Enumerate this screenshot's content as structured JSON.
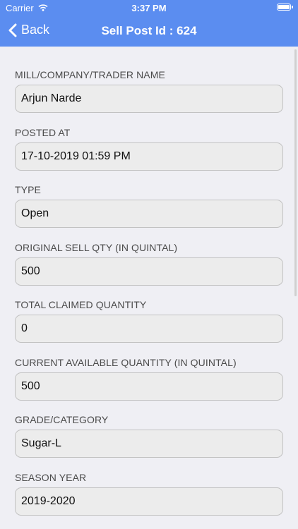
{
  "status": {
    "carrier": "Carrier",
    "time": "3:37 PM"
  },
  "nav": {
    "back_label": "Back",
    "title": "Sell Post Id : 624"
  },
  "fields": [
    {
      "label": "MILL/COMPANY/TRADER NAME",
      "value": "Arjun Narde"
    },
    {
      "label": "POSTED AT",
      "value": "17-10-2019 01:59 PM"
    },
    {
      "label": "TYPE",
      "value": "Open"
    },
    {
      "label": "ORIGINAL SELL QTY (IN QUINTAL)",
      "value": "500"
    },
    {
      "label": "TOTAL CLAIMED QUANTITY",
      "value": "0"
    },
    {
      "label": "CURRENT AVAILABLE QUANTITY (IN QUINTAL)",
      "value": "500"
    },
    {
      "label": "GRADE/CATEGORY",
      "value": "Sugar-L"
    },
    {
      "label": "SEASON YEAR",
      "value": "2019-2020"
    }
  ]
}
